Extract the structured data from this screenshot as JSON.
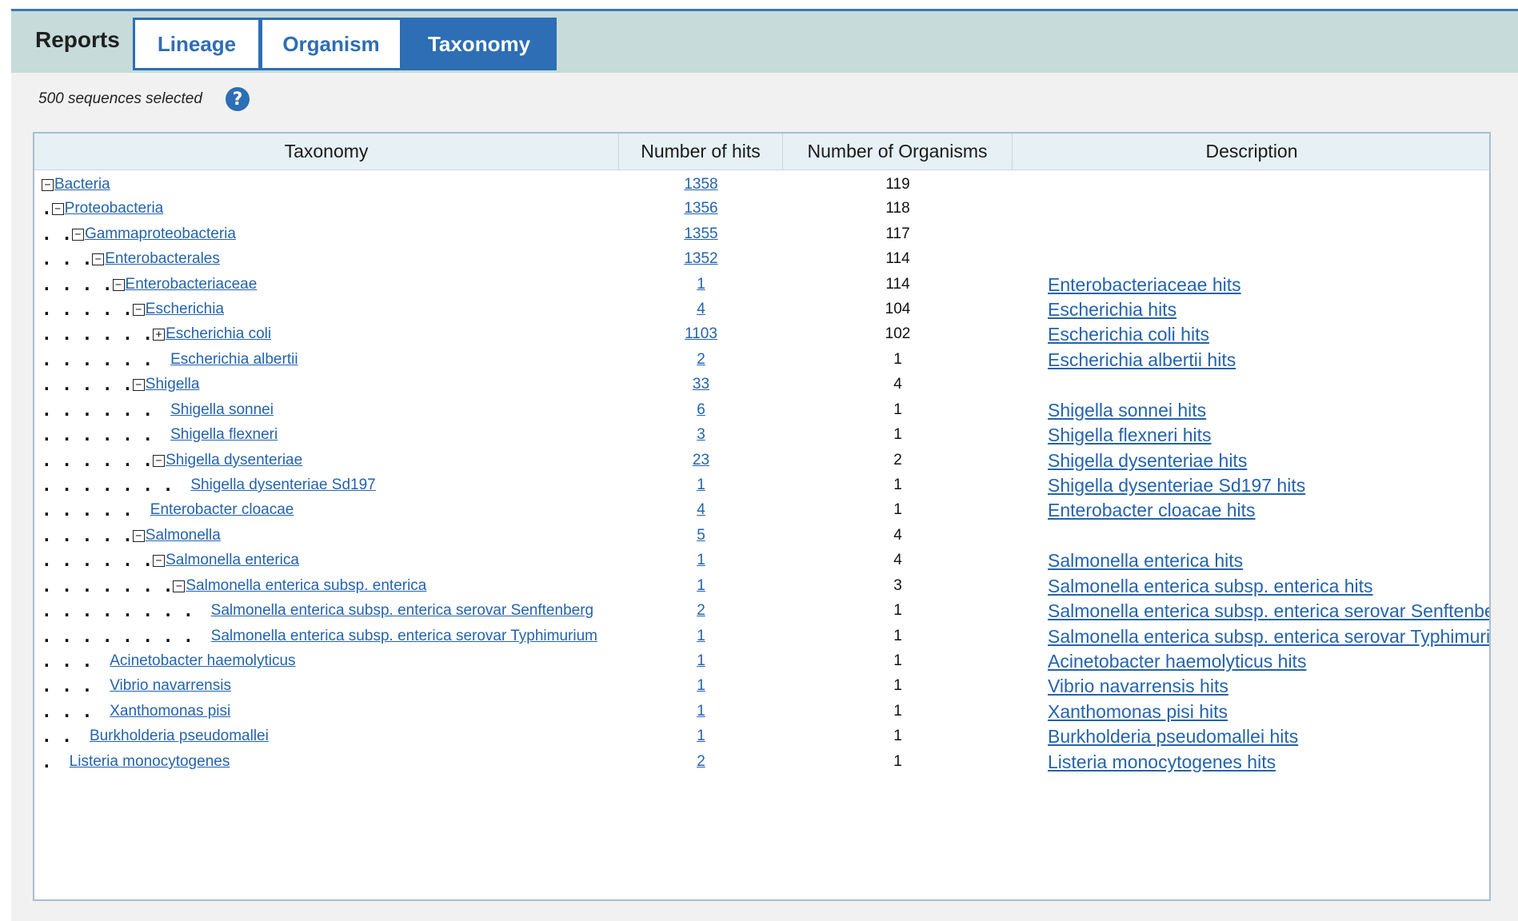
{
  "tabs": {
    "reports_label": "Reports",
    "items": [
      "Lineage",
      "Organism",
      "Taxonomy"
    ],
    "active": "Taxonomy"
  },
  "selection_info": "500 sequences selected",
  "help_icon": "question-circle-icon",
  "table": {
    "headers": [
      "Taxonomy",
      "Number of hits",
      "Number of Organisms",
      "Description"
    ],
    "rows": [
      {
        "depth": 0,
        "toggle": "minus",
        "name": "Bacteria",
        "hits": "1358",
        "organisms": "119",
        "description": ""
      },
      {
        "depth": 1,
        "toggle": "minus",
        "name": "Proteobacteria",
        "hits": "1356",
        "organisms": "118",
        "description": ""
      },
      {
        "depth": 2,
        "toggle": "minus",
        "name": "Gammaproteobacteria",
        "hits": "1355",
        "organisms": "117",
        "description": ""
      },
      {
        "depth": 3,
        "toggle": "minus",
        "name": "Enterobacterales",
        "hits": "1352",
        "organisms": "114",
        "description": ""
      },
      {
        "depth": 4,
        "toggle": "minus",
        "name": "Enterobacteriaceae",
        "hits": "1",
        "organisms": "114",
        "description": "Enterobacteriaceae hits"
      },
      {
        "depth": 5,
        "toggle": "minus",
        "name": "Escherichia",
        "hits": "4",
        "organisms": "104",
        "description": "Escherichia hits"
      },
      {
        "depth": 6,
        "toggle": "plus",
        "name": "Escherichia coli",
        "hits": "1103",
        "organisms": "102",
        "description": "Escherichia coli hits"
      },
      {
        "depth": 6,
        "toggle": "none",
        "name": "Escherichia albertii",
        "hits": "2",
        "organisms": "1",
        "description": "Escherichia albertii hits"
      },
      {
        "depth": 5,
        "toggle": "minus",
        "name": "Shigella",
        "hits": "33",
        "organisms": "4",
        "description": ""
      },
      {
        "depth": 6,
        "toggle": "none",
        "name": "Shigella sonnei",
        "hits": "6",
        "organisms": "1",
        "description": "Shigella sonnei hits"
      },
      {
        "depth": 6,
        "toggle": "none",
        "name": "Shigella flexneri",
        "hits": "3",
        "organisms": "1",
        "description": "Shigella flexneri hits"
      },
      {
        "depth": 6,
        "toggle": "minus",
        "name": "Shigella dysenteriae",
        "hits": "23",
        "organisms": "2",
        "description": "Shigella dysenteriae hits"
      },
      {
        "depth": 7,
        "toggle": "none",
        "name": "Shigella dysenteriae Sd197",
        "hits": "1",
        "organisms": "1",
        "description": "Shigella dysenteriae Sd197 hits"
      },
      {
        "depth": 5,
        "toggle": "none",
        "name": "Enterobacter cloacae",
        "hits": "4",
        "organisms": "1",
        "description": "Enterobacter cloacae hits"
      },
      {
        "depth": 5,
        "toggle": "minus",
        "name": "Salmonella",
        "hits": "5",
        "organisms": "4",
        "description": ""
      },
      {
        "depth": 6,
        "toggle": "minus",
        "name": "Salmonella enterica",
        "hits": "1",
        "organisms": "4",
        "description": "Salmonella enterica hits"
      },
      {
        "depth": 7,
        "toggle": "minus",
        "name": "Salmonella enterica subsp. enterica",
        "hits": "1",
        "organisms": "3",
        "description": "Salmonella enterica subsp. enterica hits"
      },
      {
        "depth": 8,
        "toggle": "none",
        "name": "Salmonella enterica subsp. enterica serovar Senftenberg",
        "hits": "2",
        "organisms": "1",
        "description": "Salmonella enterica subsp. enterica serovar Senftenberg hits"
      },
      {
        "depth": 8,
        "toggle": "none",
        "name": "Salmonella enterica subsp. enterica serovar Typhimurium",
        "hits": "1",
        "organisms": "1",
        "description": "Salmonella enterica subsp. enterica serovar Typhimurium hits"
      },
      {
        "depth": 3,
        "toggle": "none",
        "name": "Acinetobacter haemolyticus",
        "hits": "1",
        "organisms": "1",
        "description": "Acinetobacter haemolyticus hits"
      },
      {
        "depth": 3,
        "toggle": "none",
        "name": "Vibrio navarrensis",
        "hits": "1",
        "organisms": "1",
        "description": "Vibrio navarrensis hits"
      },
      {
        "depth": 3,
        "toggle": "none",
        "name": "Xanthomonas pisi",
        "hits": "1",
        "organisms": "1",
        "description": "Xanthomonas pisi hits"
      },
      {
        "depth": 2,
        "toggle": "none",
        "name": "Burkholderia pseudomallei",
        "hits": "1",
        "organisms": "1",
        "description": "Burkholderia pseudomallei hits"
      },
      {
        "depth": 1,
        "toggle": "none",
        "name": "Listeria monocytogenes",
        "hits": "2",
        "organisms": "1",
        "description": "Listeria monocytogenes hits"
      }
    ]
  }
}
